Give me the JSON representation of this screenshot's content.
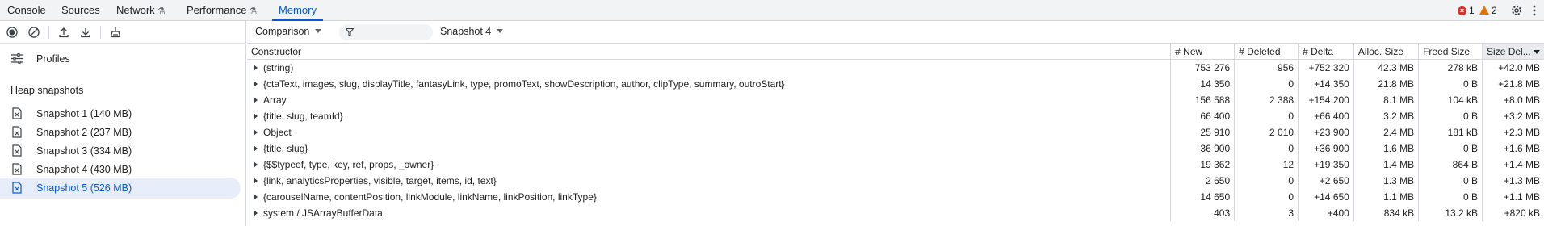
{
  "tabs": [
    {
      "label": "Console",
      "experimental": false,
      "active": false
    },
    {
      "label": "Sources",
      "experimental": false,
      "active": false
    },
    {
      "label": "Network",
      "experimental": true,
      "active": false
    },
    {
      "label": "Performance",
      "experimental": true,
      "active": false
    },
    {
      "label": "Memory",
      "experimental": false,
      "active": true
    }
  ],
  "status": {
    "errors": "1",
    "warnings": "2"
  },
  "sidebar": {
    "profiles_label": "Profiles",
    "heap_title": "Heap snapshots",
    "snapshots": [
      {
        "label": "Snapshot 1 (140 MB)"
      },
      {
        "label": "Snapshot 2 (237 MB)"
      },
      {
        "label": "Snapshot 3 (334 MB)"
      },
      {
        "label": "Snapshot 4 (430 MB)"
      },
      {
        "label": "Snapshot 5 (526 MB)",
        "selected": true
      }
    ]
  },
  "toolbar": {
    "view_mode": "Comparison",
    "filter_value": "",
    "base_snapshot": "Snapshot 4"
  },
  "table": {
    "headers": [
      "Constructor",
      "# New",
      "# Deleted",
      "# Delta",
      "Alloc. Size",
      "Freed Size",
      "Size Del..."
    ],
    "rows": [
      [
        "(string)",
        "753 276",
        "956",
        "+752 320",
        "42.3 MB",
        "278 kB",
        "+42.0 MB"
      ],
      [
        "{ctaText, images, slug, displayTitle, fantasyLink, type, promoText, showDescription, author, clipType, summary, outroStart}",
        "14 350",
        "0",
        "+14 350",
        "21.8 MB",
        "0 B",
        "+21.8 MB"
      ],
      [
        "Array",
        "156 588",
        "2 388",
        "+154 200",
        "8.1 MB",
        "104 kB",
        "+8.0 MB"
      ],
      [
        "{title, slug, teamId}",
        "66 400",
        "0",
        "+66 400",
        "3.2 MB",
        "0 B",
        "+3.2 MB"
      ],
      [
        "Object",
        "25 910",
        "2 010",
        "+23 900",
        "2.4 MB",
        "181 kB",
        "+2.3 MB"
      ],
      [
        "{title, slug}",
        "36 900",
        "0",
        "+36 900",
        "1.6 MB",
        "0 B",
        "+1.6 MB"
      ],
      [
        "{$$typeof, type, key, ref, props, _owner}",
        "19 362",
        "12",
        "+19 350",
        "1.4 MB",
        "864 B",
        "+1.4 MB"
      ],
      [
        "{link, analyticsProperties, visible, target, items, id, text}",
        "2 650",
        "0",
        "+2 650",
        "1.3 MB",
        "0 B",
        "+1.3 MB"
      ],
      [
        "{carouselName, contentPosition, linkModule, linkName, linkPosition, linkType}",
        "14 650",
        "0",
        "+14 650",
        "1.1 MB",
        "0 B",
        "+1.1 MB"
      ],
      [
        "system / JSArrayBufferData",
        "403",
        "3",
        "+400",
        "834 kB",
        "13.2 kB",
        "+820 kB"
      ]
    ]
  },
  "colors": {
    "accent": "#0b57d0",
    "error": "#d93025",
    "warning": "#e37400"
  }
}
